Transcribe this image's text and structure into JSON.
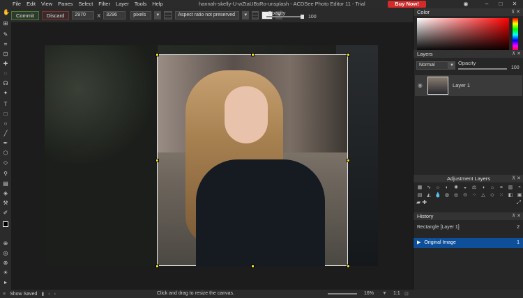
{
  "menu": {
    "items": [
      "File",
      "Edit",
      "View",
      "Panes",
      "Select",
      "Filter",
      "Layer",
      "Tools",
      "Help"
    ]
  },
  "window": {
    "title": "hannah-skelly-U-wZtaUBsRo-unsplash - ACDSee Photo Editor 11 - Trial",
    "buy_label": "Buy Now!"
  },
  "options": {
    "commit_label": "Commit",
    "discard_label": "Discard",
    "width_value": "2970",
    "x_label": "X",
    "height_value": "3296",
    "unit_value": "pixels",
    "aspect_value": "Aspect ratio not preserved",
    "opacity_label": "Opacity",
    "opacity_value": "100"
  },
  "panels": {
    "color_title": "Color",
    "layers_title": "Layers",
    "blend_mode": "Normal",
    "layer_opacity_label": "Opacity",
    "layer_opacity_value": "100",
    "layer_name": "Layer 1",
    "adjust_title": "Adjustment Layers",
    "history_title": "History",
    "history": [
      {
        "label": "Rectangle [Layer 1]",
        "num": "2"
      },
      {
        "label": "Original Image",
        "num": "1"
      }
    ]
  },
  "status": {
    "show_saved": "Show Saved",
    "hint": "Click and drag to resize the canvas.",
    "zoom": "16%",
    "zoom_ratio": "1:1"
  },
  "colors": {
    "accent_select": "#0e4f9a",
    "buy": "#d52a2a",
    "handle": "#f0e020"
  }
}
